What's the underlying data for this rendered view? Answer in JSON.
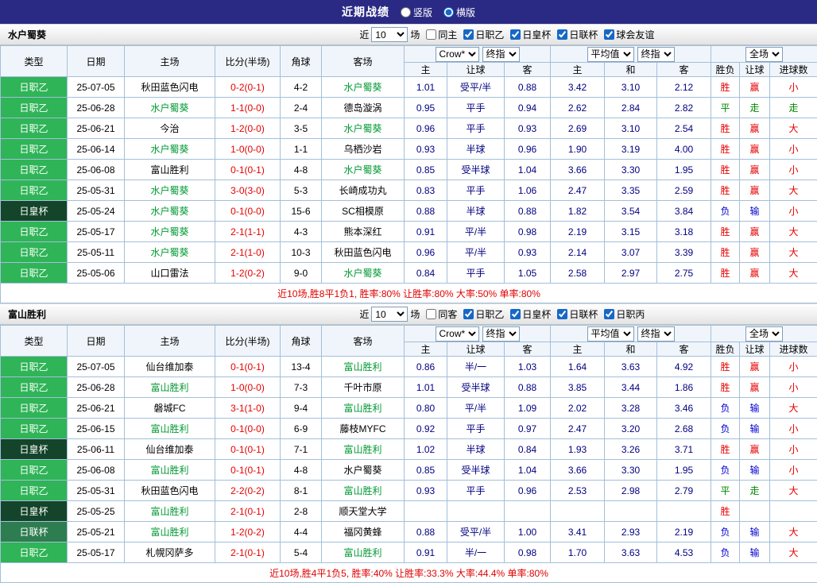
{
  "topbar": {
    "title": "近期战绩",
    "options": [
      {
        "label": "竖版",
        "selected": false
      },
      {
        "label": "横版",
        "selected": true
      }
    ]
  },
  "colors": {
    "topbar_bg": "#2a2a85",
    "accent": "#1668c7",
    "league": {
      "日职乙": "#2fb457",
      "日皇杯": "#14452a",
      "日联杯": "#2e7d50"
    },
    "result": {
      "胜": "#e60000",
      "赢": "#e60000",
      "大": "#e60000",
      "小": "#e60000",
      "平": "#008800",
      "走": "#008800",
      "负": "#0000d0",
      "输": "#0000d0"
    },
    "score": "#e60000",
    "focus_team": "#009933",
    "odds_text": "#000080",
    "summary": "#e00000"
  },
  "table_header": {
    "static": [
      "类型",
      "日期",
      "主场",
      "比分(半场)",
      "角球",
      "客场"
    ],
    "groups": [
      {
        "selects": [
          "Crow*",
          "终指"
        ],
        "cols": [
          "主",
          "让球",
          "客"
        ]
      },
      {
        "selects": [
          "平均值",
          "终指"
        ],
        "cols": [
          "主",
          "和",
          "客"
        ]
      },
      {
        "selects": [
          "全场"
        ],
        "cols": [
          "胜负",
          "让球",
          "进球数"
        ]
      }
    ]
  },
  "sections": [
    {
      "team": "水户蜀葵",
      "controls": {
        "prefix": "近",
        "count": "10",
        "suffix": "场",
        "checkboxes": [
          {
            "label": "同主",
            "checked": false
          },
          {
            "label": "日职乙",
            "checked": true
          },
          {
            "label": "日皇杯",
            "checked": true
          },
          {
            "label": "日联杯",
            "checked": true
          },
          {
            "label": "球会友谊",
            "checked": true
          }
        ]
      },
      "rows": [
        {
          "league": "日职乙",
          "date": "25-07-05",
          "home": "秋田蓝色闪电",
          "home_focus": false,
          "score": "0-2(0-1)",
          "corner": "4-2",
          "away": "水户蜀葵",
          "away_focus": true,
          "odds": [
            "1.01",
            "受平/半",
            "0.88",
            "3.42",
            "3.10",
            "2.12"
          ],
          "results": [
            "胜",
            "赢",
            "小"
          ]
        },
        {
          "league": "日职乙",
          "date": "25-06-28",
          "home": "水户蜀葵",
          "home_focus": true,
          "score": "1-1(0-0)",
          "corner": "2-4",
          "away": "德岛漩涡",
          "away_focus": false,
          "odds": [
            "0.95",
            "平手",
            "0.94",
            "2.62",
            "2.84",
            "2.82"
          ],
          "results": [
            "平",
            "走",
            "走"
          ]
        },
        {
          "league": "日职乙",
          "date": "25-06-21",
          "home": "今治",
          "home_focus": false,
          "score": "1-2(0-0)",
          "corner": "3-5",
          "away": "水户蜀葵",
          "away_focus": true,
          "odds": [
            "0.96",
            "平手",
            "0.93",
            "2.69",
            "3.10",
            "2.54"
          ],
          "results": [
            "胜",
            "赢",
            "大"
          ]
        },
        {
          "league": "日职乙",
          "date": "25-06-14",
          "home": "水户蜀葵",
          "home_focus": true,
          "score": "1-0(0-0)",
          "corner": "1-1",
          "away": "乌栖沙岩",
          "away_focus": false,
          "odds": [
            "0.93",
            "半球",
            "0.96",
            "1.90",
            "3.19",
            "4.00"
          ],
          "results": [
            "胜",
            "赢",
            "小"
          ]
        },
        {
          "league": "日职乙",
          "date": "25-06-08",
          "home": "富山胜利",
          "home_focus": false,
          "score": "0-1(0-1)",
          "corner": "4-8",
          "away": "水户蜀葵",
          "away_focus": true,
          "odds": [
            "0.85",
            "受半球",
            "1.04",
            "3.66",
            "3.30",
            "1.95"
          ],
          "results": [
            "胜",
            "赢",
            "小"
          ]
        },
        {
          "league": "日职乙",
          "date": "25-05-31",
          "home": "水户蜀葵",
          "home_focus": true,
          "score": "3-0(3-0)",
          "corner": "5-3",
          "away": "长崎成功丸",
          "away_focus": false,
          "odds": [
            "0.83",
            "平手",
            "1.06",
            "2.47",
            "3.35",
            "2.59"
          ],
          "results": [
            "胜",
            "赢",
            "大"
          ]
        },
        {
          "league": "日皇杯",
          "date": "25-05-24",
          "home": "水户蜀葵",
          "home_focus": true,
          "score": "0-1(0-0)",
          "corner": "15-6",
          "away": "SC相模原",
          "away_focus": false,
          "odds": [
            "0.88",
            "半球",
            "0.88",
            "1.82",
            "3.54",
            "3.84"
          ],
          "results": [
            "负",
            "输",
            "小"
          ]
        },
        {
          "league": "日职乙",
          "date": "25-05-17",
          "home": "水户蜀葵",
          "home_focus": true,
          "score": "2-1(1-1)",
          "corner": "4-3",
          "away": "熊本深红",
          "away_focus": false,
          "odds": [
            "0.91",
            "平/半",
            "0.98",
            "2.19",
            "3.15",
            "3.18"
          ],
          "results": [
            "胜",
            "赢",
            "大"
          ]
        },
        {
          "league": "日职乙",
          "date": "25-05-11",
          "home": "水户蜀葵",
          "home_focus": true,
          "score": "2-1(1-0)",
          "corner": "10-3",
          "away": "秋田蓝色闪电",
          "away_focus": false,
          "odds": [
            "0.96",
            "平/半",
            "0.93",
            "2.14",
            "3.07",
            "3.39"
          ],
          "results": [
            "胜",
            "赢",
            "大"
          ]
        },
        {
          "league": "日职乙",
          "date": "25-05-06",
          "home": "山口雷法",
          "home_focus": false,
          "score": "1-2(0-2)",
          "corner": "9-0",
          "away": "水户蜀葵",
          "away_focus": true,
          "odds": [
            "0.84",
            "平手",
            "1.05",
            "2.58",
            "2.97",
            "2.75"
          ],
          "results": [
            "胜",
            "赢",
            "大"
          ]
        }
      ],
      "summary": "近10场,胜8平1负1, 胜率:80% 让胜率:80% 大率:50% 单率:80%"
    },
    {
      "team": "富山胜利",
      "controls": {
        "prefix": "近",
        "count": "10",
        "suffix": "场",
        "checkboxes": [
          {
            "label": "同客",
            "checked": false
          },
          {
            "label": "日职乙",
            "checked": true
          },
          {
            "label": "日皇杯",
            "checked": true
          },
          {
            "label": "日联杯",
            "checked": true
          },
          {
            "label": "日职丙",
            "checked": true
          }
        ]
      },
      "rows": [
        {
          "league": "日职乙",
          "date": "25-07-05",
          "home": "仙台维加泰",
          "home_focus": false,
          "score": "0-1(0-1)",
          "corner": "13-4",
          "away": "富山胜利",
          "away_focus": true,
          "odds": [
            "0.86",
            "半/一",
            "1.03",
            "1.64",
            "3.63",
            "4.92"
          ],
          "results": [
            "胜",
            "赢",
            "小"
          ]
        },
        {
          "league": "日职乙",
          "date": "25-06-28",
          "home": "富山胜利",
          "home_focus": true,
          "score": "1-0(0-0)",
          "corner": "7-3",
          "away": "千叶市原",
          "away_focus": false,
          "odds": [
            "1.01",
            "受半球",
            "0.88",
            "3.85",
            "3.44",
            "1.86"
          ],
          "results": [
            "胜",
            "赢",
            "小"
          ]
        },
        {
          "league": "日职乙",
          "date": "25-06-21",
          "home": "磐城FC",
          "home_focus": false,
          "score": "3-1(1-0)",
          "corner": "9-4",
          "away": "富山胜利",
          "away_focus": true,
          "odds": [
            "0.80",
            "平/半",
            "1.09",
            "2.02",
            "3.28",
            "3.46"
          ],
          "results": [
            "负",
            "输",
            "大"
          ]
        },
        {
          "league": "日职乙",
          "date": "25-06-15",
          "home": "富山胜利",
          "home_focus": true,
          "score": "0-1(0-0)",
          "corner": "6-9",
          "away": "藤枝MYFC",
          "away_focus": false,
          "odds": [
            "0.92",
            "平手",
            "0.97",
            "2.47",
            "3.20",
            "2.68"
          ],
          "results": [
            "负",
            "输",
            "小"
          ]
        },
        {
          "league": "日皇杯",
          "date": "25-06-11",
          "home": "仙台维加泰",
          "home_focus": false,
          "score": "0-1(0-1)",
          "corner": "7-1",
          "away": "富山胜利",
          "away_focus": true,
          "odds": [
            "1.02",
            "半球",
            "0.84",
            "1.93",
            "3.26",
            "3.71"
          ],
          "results": [
            "胜",
            "赢",
            "小"
          ]
        },
        {
          "league": "日职乙",
          "date": "25-06-08",
          "home": "富山胜利",
          "home_focus": true,
          "score": "0-1(0-1)",
          "corner": "4-8",
          "away": "水户蜀葵",
          "away_focus": false,
          "odds": [
            "0.85",
            "受半球",
            "1.04",
            "3.66",
            "3.30",
            "1.95"
          ],
          "results": [
            "负",
            "输",
            "小"
          ]
        },
        {
          "league": "日职乙",
          "date": "25-05-31",
          "home": "秋田蓝色闪电",
          "home_focus": false,
          "score": "2-2(0-2)",
          "corner": "8-1",
          "away": "富山胜利",
          "away_focus": true,
          "odds": [
            "0.93",
            "平手",
            "0.96",
            "2.53",
            "2.98",
            "2.79"
          ],
          "results": [
            "平",
            "走",
            "大"
          ]
        },
        {
          "league": "日皇杯",
          "date": "25-05-25",
          "home": "富山胜利",
          "home_focus": true,
          "score": "2-1(0-1)",
          "corner": "2-8",
          "away": "顺天堂大学",
          "away_focus": false,
          "odds": [
            "",
            "",
            "",
            "",
            "",
            ""
          ],
          "results": [
            "胜",
            "",
            ""
          ]
        },
        {
          "league": "日联杯",
          "date": "25-05-21",
          "home": "富山胜利",
          "home_focus": true,
          "score": "1-2(0-2)",
          "corner": "4-4",
          "away": "福冈黄蜂",
          "away_focus": false,
          "odds": [
            "0.88",
            "受平/半",
            "1.00",
            "3.41",
            "2.93",
            "2.19"
          ],
          "results": [
            "负",
            "输",
            "大"
          ]
        },
        {
          "league": "日职乙",
          "date": "25-05-17",
          "home": "札幌冈萨多",
          "home_focus": false,
          "score": "2-1(0-1)",
          "corner": "5-4",
          "away": "富山胜利",
          "away_focus": true,
          "odds": [
            "0.91",
            "半/一",
            "0.98",
            "1.70",
            "3.63",
            "4.53"
          ],
          "results": [
            "负",
            "输",
            "大"
          ]
        }
      ],
      "summary": "近10场,胜4平1负5, 胜率:40% 让胜率:33.3% 大率:44.4% 单率:80%"
    }
  ]
}
